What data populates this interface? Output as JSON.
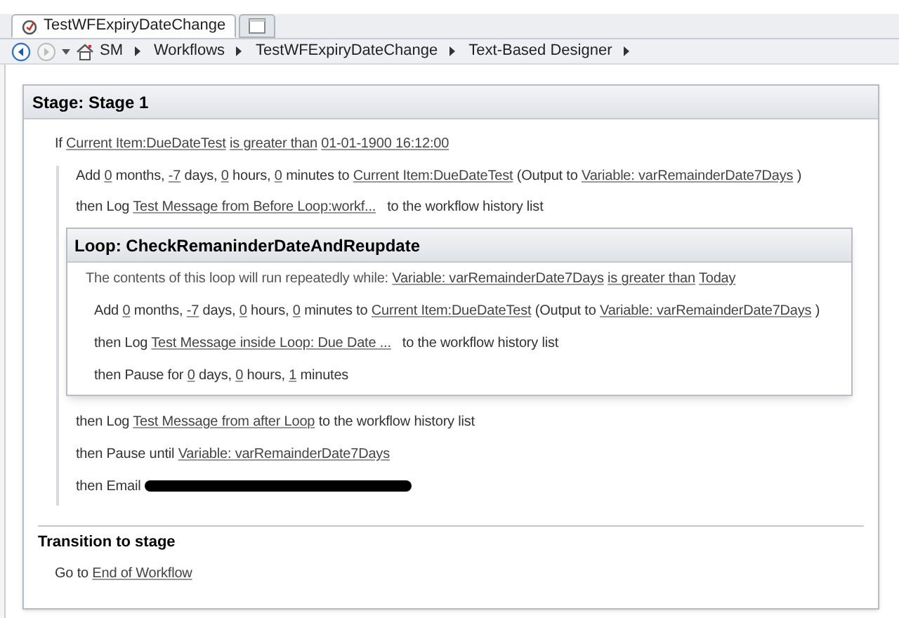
{
  "tabs": [
    {
      "label": "TestWFExpiryDateChange",
      "selected": true
    },
    {
      "selected": false,
      "kind": "new"
    }
  ],
  "breadcrumb": [
    "SM",
    "Workflows",
    "TestWFExpiryDateChange",
    "Text-Based Designer"
  ],
  "stage": {
    "title": "Stage: Stage 1",
    "condition": [
      {
        "kind": "text",
        "text": "If"
      },
      {
        "kind": "link",
        "text": "Current Item:DueDateTest"
      },
      {
        "kind": "link",
        "text": "is greater than"
      },
      {
        "kind": "link",
        "text": "01-01-1900 16:12:00"
      }
    ],
    "before_loop": [
      [
        {
          "kind": "text",
          "text": "Add"
        },
        {
          "kind": "link",
          "text": "0"
        },
        {
          "kind": "text",
          "text": "months,"
        },
        {
          "kind": "link",
          "text": "-7"
        },
        {
          "kind": "text",
          "text": "days,"
        },
        {
          "kind": "link",
          "text": "0"
        },
        {
          "kind": "text",
          "text": "hours,"
        },
        {
          "kind": "link",
          "text": "0"
        },
        {
          "kind": "text",
          "text": "minutes to"
        },
        {
          "kind": "link",
          "text": "Current Item:DueDateTest"
        },
        {
          "kind": "text",
          "text": "(Output to"
        },
        {
          "kind": "link",
          "text": "Variable: varRemainderDate7Days"
        },
        {
          "kind": "text",
          "text": ")"
        }
      ],
      [
        {
          "kind": "text",
          "text": "then Log"
        },
        {
          "kind": "link",
          "text": "Test Message from Before Loop:workf..."
        },
        {
          "kind": "text",
          "text": "  to the workflow history list"
        }
      ]
    ],
    "loop": {
      "title": "Loop: CheckRemaninderDateAndReupdate",
      "condition": [
        {
          "kind": "text",
          "text": "The contents of this loop will run repeatedly while:"
        },
        {
          "kind": "link",
          "text": "Variable: varRemainderDate7Days"
        },
        {
          "kind": "link",
          "text": "is greater than"
        },
        {
          "kind": "link",
          "text": "Today"
        }
      ],
      "steps": [
        [
          {
            "kind": "text",
            "text": "Add"
          },
          {
            "kind": "link",
            "text": "0"
          },
          {
            "kind": "text",
            "text": "months,"
          },
          {
            "kind": "link",
            "text": "-7"
          },
          {
            "kind": "text",
            "text": "days,"
          },
          {
            "kind": "link",
            "text": "0"
          },
          {
            "kind": "text",
            "text": "hours,"
          },
          {
            "kind": "link",
            "text": "0"
          },
          {
            "kind": "text",
            "text": "minutes to"
          },
          {
            "kind": "link",
            "text": "Current Item:DueDateTest"
          },
          {
            "kind": "text",
            "text": "(Output to"
          },
          {
            "kind": "link",
            "text": "Variable: varRemainderDate7Days"
          },
          {
            "kind": "text",
            "text": ")"
          }
        ],
        [
          {
            "kind": "text",
            "text": "then Log"
          },
          {
            "kind": "link",
            "text": "Test Message inside Loop: Due Date ..."
          },
          {
            "kind": "text",
            "text": "  to the workflow history list"
          }
        ],
        [
          {
            "kind": "text",
            "text": "then Pause for"
          },
          {
            "kind": "link",
            "text": "0"
          },
          {
            "kind": "text",
            "text": "days,"
          },
          {
            "kind": "link",
            "text": "0"
          },
          {
            "kind": "text",
            "text": "hours,"
          },
          {
            "kind": "link",
            "text": "1"
          },
          {
            "kind": "text",
            "text": "minutes"
          }
        ]
      ]
    },
    "after_loop": [
      [
        {
          "kind": "text",
          "text": "then Log"
        },
        {
          "kind": "link",
          "text": "Test Message from after Loop"
        },
        {
          "kind": "text",
          "text": "to the workflow history list"
        }
      ],
      [
        {
          "kind": "text",
          "text": "then Pause until"
        },
        {
          "kind": "link",
          "text": "Variable: varRemainderDate7Days"
        }
      ],
      [
        {
          "kind": "text",
          "text": "then Email"
        },
        {
          "kind": "redacted"
        }
      ]
    ],
    "transition": {
      "title": "Transition to stage",
      "step": [
        {
          "kind": "text",
          "text": "Go to"
        },
        {
          "kind": "link",
          "text": "End of Workflow"
        }
      ]
    }
  }
}
